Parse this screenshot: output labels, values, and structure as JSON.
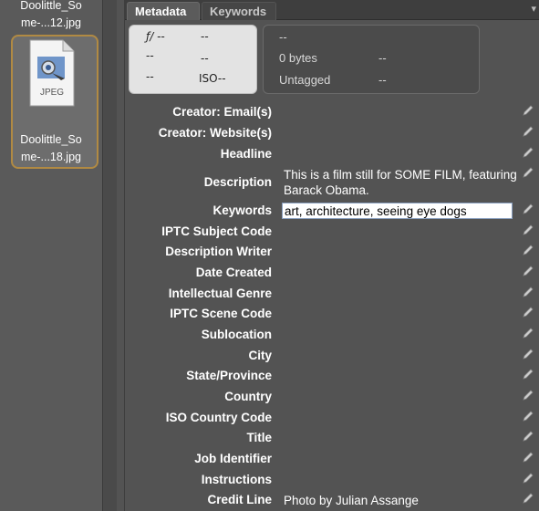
{
  "thumbnails": [
    {
      "line1": "Doolittle_So",
      "line2": "me-...12.jpg"
    },
    {
      "line1": "Doolittle_So",
      "line2": "me-...18.jpg",
      "badge": "JPEG"
    }
  ],
  "tabs": [
    "Metadata",
    "Keywords"
  ],
  "camera": {
    "aperture": "ƒ/ --",
    "shutter": "--",
    "r2c1": "--",
    "r2c2": "--",
    "r3c1": "--",
    "iso": "ISO--"
  },
  "file_info": {
    "top": "--",
    "size": "0 bytes",
    "size_val": "--",
    "label": "Untagged",
    "label_val": "--"
  },
  "fields": [
    {
      "label": "Creator: Email(s)",
      "value": ""
    },
    {
      "label": "Creator: Website(s)",
      "value": ""
    },
    {
      "label": "Headline",
      "value": ""
    },
    {
      "label": "Description",
      "value": "This is a film still for SOME FILM, featuring Barack Obama."
    },
    {
      "label": "Keywords",
      "value": "art, architecture, seeing eye dogs"
    },
    {
      "label": "IPTC Subject Code",
      "value": ""
    },
    {
      "label": "Description Writer",
      "value": ""
    },
    {
      "label": "Date Created",
      "value": ""
    },
    {
      "label": "Intellectual Genre",
      "value": ""
    },
    {
      "label": "IPTC Scene Code",
      "value": ""
    },
    {
      "label": "Sublocation",
      "value": ""
    },
    {
      "label": "City",
      "value": ""
    },
    {
      "label": "State/Province",
      "value": ""
    },
    {
      "label": "Country",
      "value": ""
    },
    {
      "label": "ISO Country Code",
      "value": ""
    },
    {
      "label": "Title",
      "value": ""
    },
    {
      "label": "Job Identifier",
      "value": ""
    },
    {
      "label": "Instructions",
      "value": ""
    },
    {
      "label": "Credit Line",
      "value": "Photo by Julian Assange"
    }
  ],
  "colors": {
    "selection_border": "#b18a43",
    "panel_bg": "#535353"
  },
  "icons": {
    "edit": "pencil-icon",
    "file": "jpeg-file-icon",
    "menu": "panel-menu-icon"
  }
}
